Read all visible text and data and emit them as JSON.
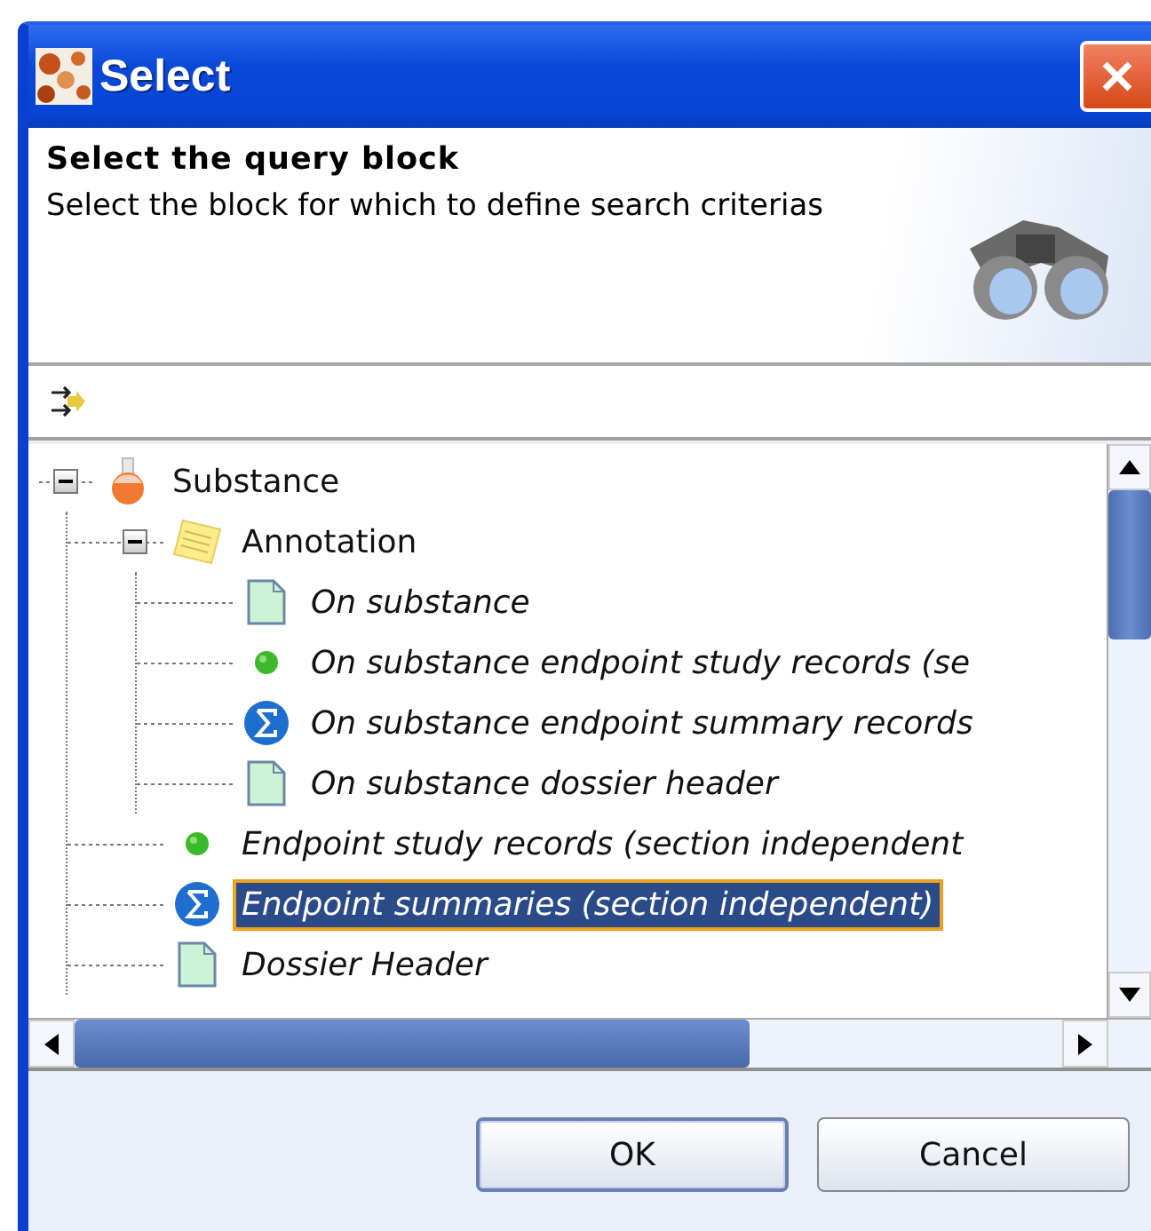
{
  "window": {
    "title": "Select"
  },
  "header": {
    "title": "Select the query block",
    "description": "Select the block for which to define search criterias"
  },
  "tree": {
    "items": [
      {
        "label": "Substance",
        "kind": "substance",
        "expanded": true,
        "selected": false,
        "children": [
          {
            "label": "Annotation",
            "kind": "note",
            "expanded": true,
            "selected": false,
            "children": [
              {
                "label": "On substance",
                "kind": "document",
                "selected": false
              },
              {
                "label": "On substance endpoint study records (se",
                "kind": "dot",
                "selected": false
              },
              {
                "label": "On substance endpoint summary records",
                "kind": "sigma",
                "selected": false
              },
              {
                "label": "On substance dossier header",
                "kind": "document",
                "selected": false
              }
            ]
          },
          {
            "label": "Endpoint study records (section independent",
            "kind": "dot",
            "selected": false
          },
          {
            "label": "Endpoint summaries (section independent)",
            "kind": "sigma",
            "selected": true
          },
          {
            "label": "Dossier Header",
            "kind": "document",
            "selected": false
          }
        ]
      }
    ]
  },
  "buttons": [
    {
      "label": "OK",
      "default": true
    },
    {
      "label": "Cancel",
      "default": false
    }
  ]
}
